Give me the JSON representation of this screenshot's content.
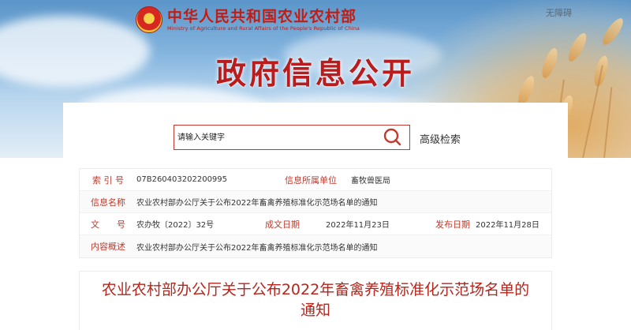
{
  "header": {
    "ministry_cn": "中华人民共和国农业农村部",
    "ministry_en": "Ministry of Agriculture and Rural Affairs of the People's Republic of China",
    "accessibility": "无障碍",
    "page_title": "政府信息公开",
    "emblem_icon": "national-emblem-icon"
  },
  "search": {
    "placeholder": "请输入关键字",
    "button_icon": "search-icon",
    "advanced_label": "高级检索"
  },
  "info": {
    "index_label": "索 引 号",
    "index_value": "07B260403202200995",
    "unit_label": "信息所属单位",
    "unit_value": "畜牧兽医局",
    "name_label": "信息名称",
    "name_value": "农业农村部办公厅关于公布2022年畜禽养殖标准化示范场名单的通知",
    "doc_no_label": "文　　号",
    "doc_no_value": "农办牧〔2022〕32号",
    "written_label": "成文日期",
    "written_value": "2022年11月23日",
    "publish_label": "发布日期",
    "publish_value": "2022年11月28日",
    "summary_label": "内容概述",
    "summary_value": "农业农村部办公厅关于公布2022年畜禽养殖标准化示范场名单的通知"
  },
  "document": {
    "title": "农业农村部办公厅关于公布2022年畜禽养殖标准化示范场名单的通知"
  },
  "colors": {
    "accent_red": "#c21d14",
    "label_red": "#c0392b",
    "sky_blue": "#86b6df"
  }
}
